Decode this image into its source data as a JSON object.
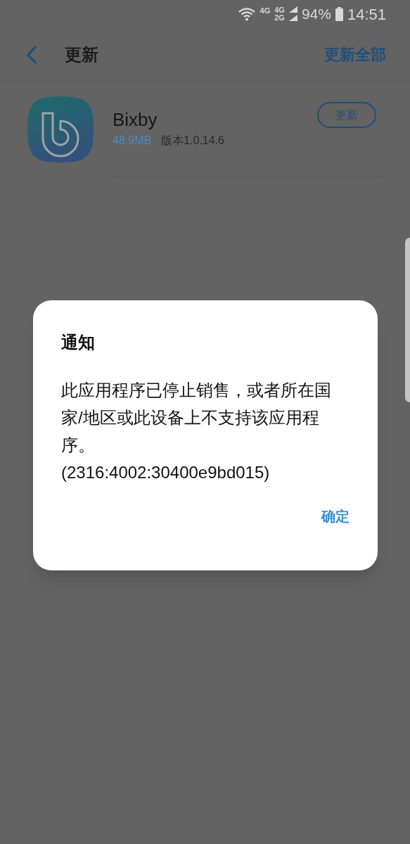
{
  "status_bar": {
    "network_1": "4G",
    "network_2": "4G",
    "network_3": "2G",
    "battery": "94%",
    "time": "14:51"
  },
  "header": {
    "title": "更新",
    "action": "更新全部"
  },
  "apps": [
    {
      "name": "Bixby",
      "size": "48.9MB",
      "version": "版本1.0.14.6",
      "button": "更新"
    }
  ],
  "dialog": {
    "title": "通知",
    "message": "此应用程序已停止销售，或者所在国家/地区或此设备上不支持该应用程序。",
    "code": "(2316:4002:30400e9bd015)",
    "button": "确定"
  }
}
